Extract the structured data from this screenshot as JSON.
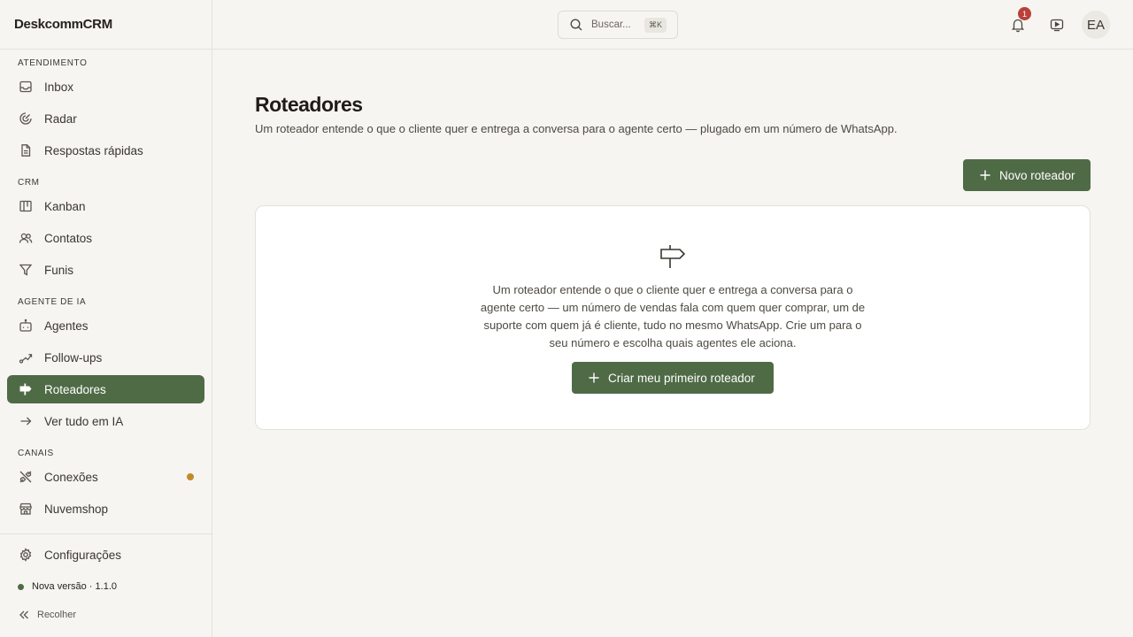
{
  "app": {
    "brand": "DeskcommCRM"
  },
  "sidebar": {
    "sections": [
      {
        "label": "ATENDIMENTO"
      },
      {
        "label": "CRM"
      },
      {
        "label": "AGENTE DE IA"
      },
      {
        "label": "CANAIS"
      }
    ],
    "items": [
      {
        "label": "Inbox",
        "icon": "inbox-icon"
      },
      {
        "label": "Radar",
        "icon": "radar-icon"
      },
      {
        "label": "Respostas rápidas",
        "icon": "document-icon"
      },
      {
        "label": "Kanban",
        "icon": "kanban-icon"
      },
      {
        "label": "Contatos",
        "icon": "contacts-icon"
      },
      {
        "label": "Funis",
        "icon": "funnel-icon"
      },
      {
        "label": "Agentes",
        "icon": "bot-icon"
      },
      {
        "label": "Follow-ups",
        "icon": "route-icon"
      },
      {
        "label": "Roteadores",
        "icon": "signpost-icon",
        "active": true
      },
      {
        "label": "Ver tudo em IA",
        "icon": "arrow-right-icon"
      },
      {
        "label": "Conexões",
        "icon": "plug-icon",
        "status_dot_color": "#c38a2a"
      },
      {
        "label": "Nuvemshop",
        "icon": "store-icon"
      },
      {
        "label": "Configurações",
        "icon": "gear-icon"
      }
    ],
    "version": "Nova versão · 1.1.0",
    "collapse_label": "Recolher"
  },
  "topbar": {
    "search_placeholder": "Buscar...",
    "search_shortcut": "⌘K",
    "notification_count": "1",
    "avatar_initials": "EA"
  },
  "main": {
    "title": "Roteadores",
    "subtitle": "Um roteador entende o que o cliente quer e entrega a conversa para o agente certo — plugado em um número de WhatsApp.",
    "new_button_label": "Novo roteador",
    "empty_state": {
      "text": "Um roteador entende o que o cliente quer e entrega a conversa para o agente certo — um número de vendas fala com quem quer comprar, um de suporte com quem já é cliente, tudo no mesmo WhatsApp. Crie um para o seu número e escolha quais agentes ele aciona.",
      "button_label": "Criar meu primeiro roteador"
    }
  },
  "colors": {
    "accent": "#4f6b46",
    "background": "#f6f5f1",
    "badge": "#b9413a",
    "status_warning": "#c38a2a"
  }
}
